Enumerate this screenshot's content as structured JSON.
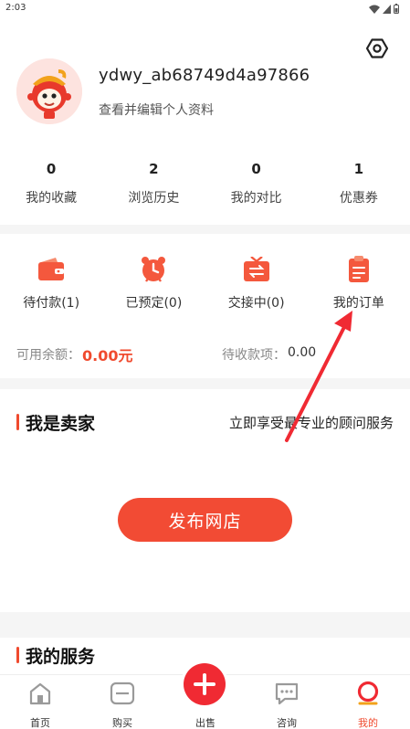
{
  "status_bar": {
    "time": "2:03"
  },
  "profile": {
    "username": "ydwy_ab68749d4a97866",
    "edit_link": "查看并编辑个人资料"
  },
  "stats": [
    {
      "value": "0",
      "label": "我的收藏"
    },
    {
      "value": "2",
      "label": "浏览历史"
    },
    {
      "value": "0",
      "label": "我的对比"
    },
    {
      "value": "1",
      "label": "优惠券"
    }
  ],
  "orders": [
    {
      "label": "待付款(1)",
      "icon": "wallet-icon"
    },
    {
      "label": "已预定(0)",
      "icon": "alarm-clock-icon"
    },
    {
      "label": "交接中(0)",
      "icon": "exchange-icon"
    },
    {
      "label": "我的订单",
      "icon": "clipboard-icon"
    }
  ],
  "balance": {
    "available_label": "可用余额：",
    "available_value": "0.00元",
    "pending_label": "待收款项：",
    "pending_value": "0.00"
  },
  "seller": {
    "title": "我是卖家",
    "subtitle": "立即享受最专业的顾问服务",
    "publish_button": "发布网店"
  },
  "services": {
    "title": "我的服务"
  },
  "tabbar": {
    "items": [
      {
        "label": "首页",
        "icon": "home-icon"
      },
      {
        "label": "购买",
        "icon": "shopping-bag-icon"
      },
      {
        "label": "出售",
        "icon": "plus-icon"
      },
      {
        "label": "咨询",
        "icon": "chat-icon"
      },
      {
        "label": "我的",
        "icon": "profile-ring-icon"
      }
    ],
    "active_index": 4
  },
  "colors": {
    "accent": "#f04a2e",
    "fab": "#f02a33",
    "band": "#f5f5f5"
  }
}
